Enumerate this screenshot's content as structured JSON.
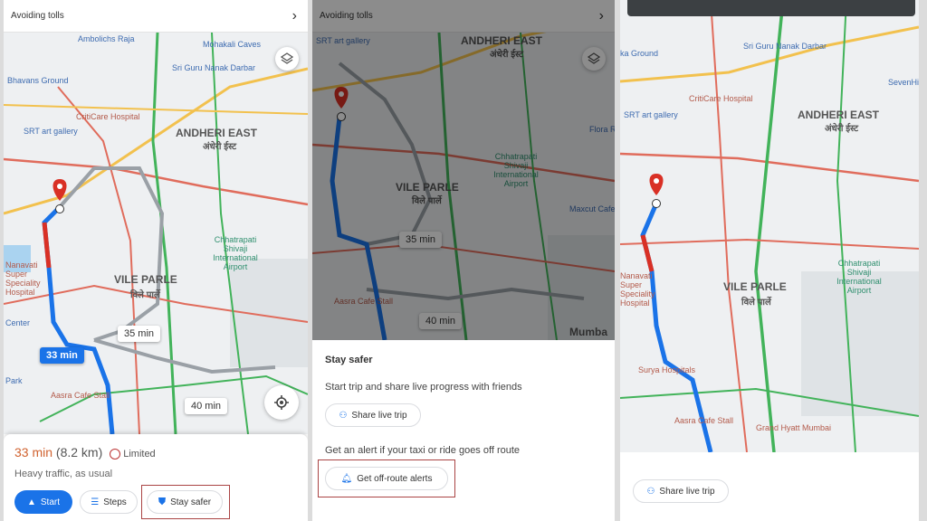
{
  "panel1": {
    "top_bar": {
      "title": "Avoiding tolls"
    },
    "map_labels": {
      "ambolichs_raja": "Ambolichs Raja",
      "mohakali_caves": "Mohakali Caves",
      "sri_guru_nanak": "Sri Guru Nanak Darbar",
      "bhavans_ground": "Bhavans Ground",
      "critical_hospital": "CritiCare Hospital",
      "srt_gallery": "SRT art gallery",
      "andheri_east": "ANDHERI EAST",
      "andheri_east_hi": "अंधेरी ईस्ट",
      "vile_parle": "VILE PARLE",
      "vile_parle_hi": "विले पार्ले",
      "chhatrapati": "Chhatrapati Shivaji International Airport",
      "nanavati": "Nanavati Super Speciality Hospital",
      "center": "Center",
      "park": "Park",
      "aasra": "Aasra Cafe Stall"
    },
    "route_times": {
      "primary": "33 min",
      "alt1": "35 min",
      "alt2": "40 min"
    },
    "sheet": {
      "duration": "33 min",
      "distance": "(8.2 km)",
      "limited": "Limited",
      "traffic": "Heavy traffic, as usual",
      "start_label": "Start",
      "steps_label": "Steps",
      "stay_safer_label": "Stay safer"
    }
  },
  "panel2": {
    "top_bar": {
      "title": "Avoiding tolls"
    },
    "map_labels": {
      "srt_gallery": "SRT art gallery",
      "andheri_east": "ANDHERI EAST",
      "andheri_east_hi": "अंधेरी ईस्ट",
      "vile_parle": "VILE PARLE",
      "vile_parle_hi": "विले पार्ले",
      "chhatrapati": "Chhatrapati Shivaji International Airport",
      "flora": "Flora Re",
      "maxcut": "Maxcut Cafe",
      "aasra": "Aasra Cafe Stall",
      "mumbai": "Mumba"
    },
    "route_times": {
      "alt1": "35 min",
      "alt2": "40 min"
    },
    "sheet": {
      "title": "Stay safer",
      "share_text": "Start trip and share live progress with friends",
      "share_button": "Share live trip",
      "alert_text": "Get an alert if your taxi or ride goes off route",
      "alert_button": "Get off-route alerts"
    }
  },
  "panel3": {
    "map_labels": {
      "sri_guru_nanak": "Sri Guru Nanak Darbar",
      "ka_ground": "ka Ground",
      "critical_hospital": "CritiCare Hospital",
      "srt_gallery": "SRT art gallery",
      "andheri_east": "ANDHERI EAST",
      "andheri_east_hi": "अंधेरी ईस्ट",
      "vile_parle": "VILE PARLE",
      "vile_parle_hi": "विले पार्ले",
      "chhatrapati": "Chhatrapati Shivaji International Airport",
      "nanavati": "Nanavati Super Speciality Hospital",
      "surya": "Surya Hospitals",
      "aasra": "Aasra Cafe Stall",
      "grand_hyatt": "Grand Hyatt Mumbai",
      "sevenhills": "SevenHil"
    },
    "share_button": "Share live trip"
  },
  "colors": {
    "route_blue": "#1a73e8",
    "highlight_box": "#a44444",
    "pin_red": "#d93025"
  }
}
